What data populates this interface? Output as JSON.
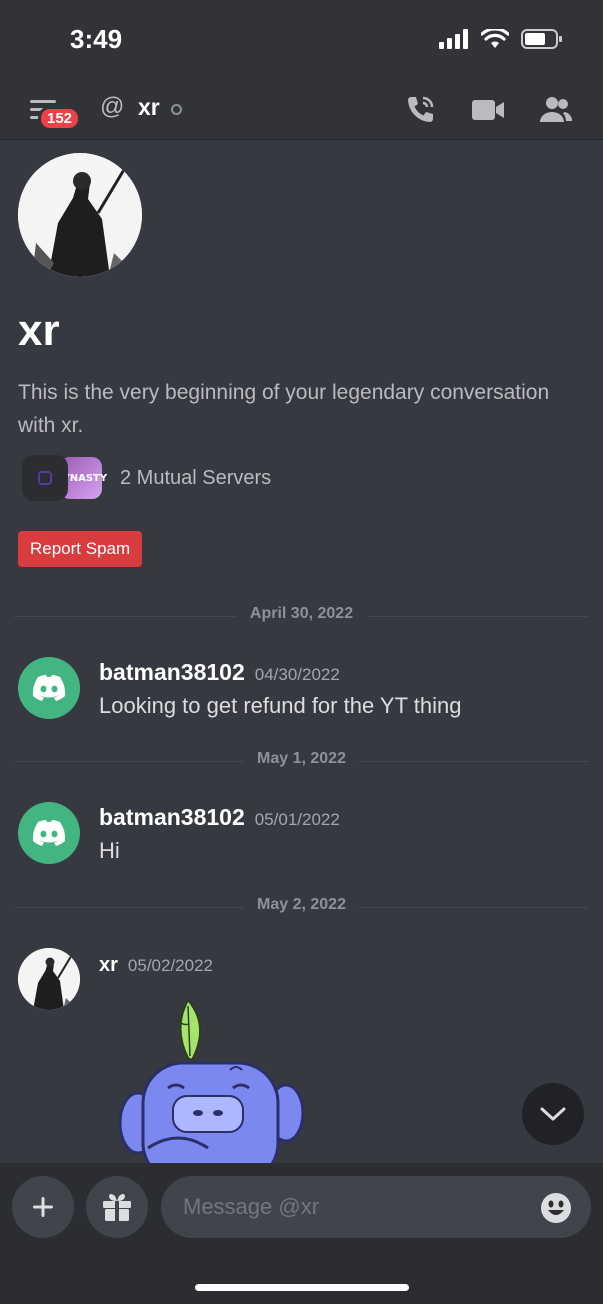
{
  "status_bar": {
    "time": "3:49"
  },
  "header": {
    "notification_count": "152",
    "at_symbol": "@",
    "channel_name": "xr"
  },
  "profile": {
    "name": "xr",
    "intro": "This is the very beginning of your legendary conversation with xr.",
    "mutual_servers": "2 Mutual Servers",
    "server_badge_text": "DYNASTY",
    "report_label": "Report Spam"
  },
  "messages": [
    {
      "date_divider": "April 30, 2022",
      "author": "batman38102",
      "timestamp": "04/30/2022",
      "text": "Looking to get refund for the YT thing"
    },
    {
      "date_divider": "May 1, 2022",
      "author": "batman38102",
      "timestamp": "05/01/2022",
      "text": "Hi"
    },
    {
      "date_divider": "May 2, 2022",
      "author": "xr",
      "timestamp": "05/02/2022",
      "text": ""
    }
  ],
  "composer": {
    "placeholder": "Message @xr"
  },
  "colors": {
    "background": "#36393f",
    "accent_red": "#ed4245",
    "online_green": "#43b581",
    "blurple": "#5865f2"
  }
}
